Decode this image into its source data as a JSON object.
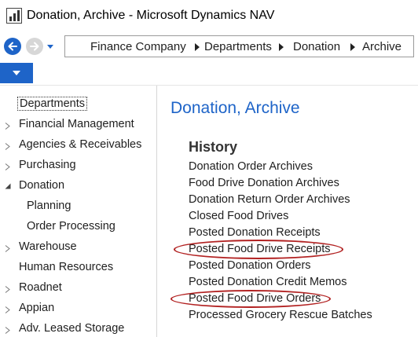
{
  "window": {
    "title": "Donation, Archive - Microsoft Dynamics NAV"
  },
  "breadcrumb": [
    "Finance Company",
    "Departments",
    "Donation",
    "Archive"
  ],
  "sidebar": {
    "items": [
      {
        "label": "Departments"
      },
      {
        "label": "Financial Management"
      },
      {
        "label": "Agencies & Receivables"
      },
      {
        "label": "Purchasing"
      },
      {
        "label": "Donation"
      },
      {
        "label": "Planning"
      },
      {
        "label": "Order Processing"
      },
      {
        "label": "Warehouse"
      },
      {
        "label": "Human Resources"
      },
      {
        "label": "Roadnet"
      },
      {
        "label": "Appian"
      },
      {
        "label": "Adv. Leased Storage"
      }
    ]
  },
  "main": {
    "title": "Donation, Archive",
    "section": "History",
    "links": [
      "Donation Order Archives",
      "Food Drive Donation Archives",
      "Donation Return Order Archives",
      "Closed Food Drives",
      "Posted Donation Receipts",
      "Posted Food Drive Receipts",
      "Posted Donation Orders",
      "Posted Donation Credit Memos",
      "Posted Food Drive Orders",
      "Processed Grocery Rescue Batches"
    ]
  },
  "colors": {
    "accent": "#1e64c8",
    "highlight_ring": "#b22222"
  }
}
